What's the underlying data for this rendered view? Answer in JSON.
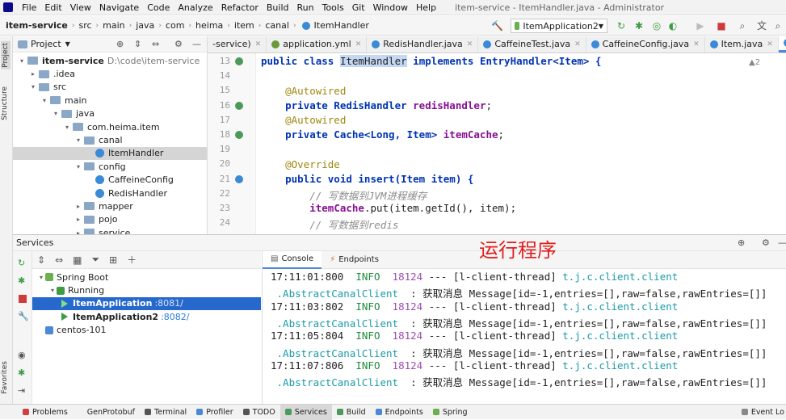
{
  "menu": {
    "items": [
      "File",
      "Edit",
      "View",
      "Navigate",
      "Code",
      "Analyze",
      "Refactor",
      "Build",
      "Run",
      "Tools",
      "Git",
      "Window",
      "Help"
    ],
    "window_title": "item-service - ItemHandler.java - Administrator"
  },
  "breadcrumb": [
    "item-service",
    "src",
    "main",
    "java",
    "com",
    "heima",
    "item",
    "canal",
    "ItemHandler"
  ],
  "run_config": "ItemApplication2",
  "project": {
    "header": "Project",
    "tree": [
      {
        "label": "item-service",
        "path": "D:\\code\\item-service",
        "indent": 0,
        "arrow": "▾",
        "icon": "folder",
        "bold": true
      },
      {
        "label": ".idea",
        "indent": 1,
        "arrow": "▸",
        "icon": "folder"
      },
      {
        "label": "src",
        "indent": 1,
        "arrow": "▾",
        "icon": "folder"
      },
      {
        "label": "main",
        "indent": 2,
        "arrow": "▾",
        "icon": "folder"
      },
      {
        "label": "java",
        "indent": 3,
        "arrow": "▾",
        "icon": "folder"
      },
      {
        "label": "com.heima.item",
        "indent": 4,
        "arrow": "▾",
        "icon": "folder"
      },
      {
        "label": "canal",
        "indent": 5,
        "arrow": "▾",
        "icon": "folder"
      },
      {
        "label": "ItemHandler",
        "indent": 6,
        "arrow": "",
        "icon": "class",
        "selected": true
      },
      {
        "label": "config",
        "indent": 5,
        "arrow": "▾",
        "icon": "folder"
      },
      {
        "label": "CaffeineConfig",
        "indent": 6,
        "arrow": "",
        "icon": "class"
      },
      {
        "label": "RedisHandler",
        "indent": 6,
        "arrow": "",
        "icon": "class"
      },
      {
        "label": "mapper",
        "indent": 5,
        "arrow": "▸",
        "icon": "folder"
      },
      {
        "label": "pojo",
        "indent": 5,
        "arrow": "▸",
        "icon": "folder"
      },
      {
        "label": "service",
        "indent": 5,
        "arrow": "▸",
        "icon": "folder"
      }
    ]
  },
  "editor_tabs": [
    {
      "label": "-service)",
      "color": "#8aa7c7"
    },
    {
      "label": "application.yml",
      "color": "#6a9a3a"
    },
    {
      "label": "RedisHandler.java",
      "color": "#3a8ad6"
    },
    {
      "label": "CaffeineTest.java",
      "color": "#3a8ad6"
    },
    {
      "label": "CaffeineConfig.java",
      "color": "#3a8ad6"
    },
    {
      "label": "Item.java",
      "color": "#3a8ad6"
    },
    {
      "label": "ItemHandler.java",
      "color": "#3a8ad6",
      "active": true
    }
  ],
  "line_numbers": [
    "13",
    "14",
    "15",
    "16",
    "17",
    "18",
    "19",
    "20",
    "21",
    "22",
    "23",
    "24"
  ],
  "warning_count": "▲2",
  "code": {
    "l13a": "public class ",
    "l13b": "ItemHandler",
    "l13c": " implements EntryHandler<Item> {",
    "l15": "    @Autowired",
    "l16a": "    private RedisHandler ",
    "l16b": "redisHandler",
    "l17": "    @Autowired",
    "l18a": "    private Cache<Long, Item> ",
    "l18b": "itemCache",
    "l20": "    @Override",
    "l21": "    public void insert(Item item) {",
    "l22": "        // 写数据到JVM进程缓存",
    "l23a": "        ",
    "l23b": "itemCache",
    "l23c": ".put(item.getId(), item);",
    "l24": "        // 写数据到redis"
  },
  "services": {
    "header": "Services",
    "tree": [
      {
        "label": "Spring Boot",
        "indent": 0
      },
      {
        "label": "Running",
        "indent": 1
      },
      {
        "label": "ItemApplication",
        "port": ":8081/",
        "indent": 2,
        "selected": true
      },
      {
        "label": "ItemApplication2",
        "port": ":8082/",
        "indent": 2
      },
      {
        "label": "centos-101",
        "indent": 0
      }
    ]
  },
  "console_tabs": [
    "Console",
    "Endpoints"
  ],
  "annotation": "运行程序",
  "logs": [
    {
      "time": "17:11:01:800",
      "level": "INFO",
      "pid": "18124",
      "thread": " --- [l-client-thread] ",
      "cls": "t.j.c.client.client",
      "cls2": " .AbstractCanalClient",
      "msg": "  : 获取消息 Message[id=-1,entries=[],raw=false,rawEntries=[]]"
    },
    {
      "time": "17:11:03:802",
      "level": "INFO",
      "pid": "18124",
      "thread": " --- [l-client-thread] ",
      "cls": "t.j.c.client.client",
      "cls2": " .AbstractCanalClient",
      "msg": "  : 获取消息 Message[id=-1,entries=[],raw=false,rawEntries=[]]"
    },
    {
      "time": "17:11:05:804",
      "level": "INFO",
      "pid": "18124",
      "thread": " --- [l-client-thread] ",
      "cls": "t.j.c.client.client",
      "cls2": " .AbstractCanalClient",
      "msg": "  : 获取消息 Message[id=-1,entries=[],raw=false,rawEntries=[]]"
    },
    {
      "time": "17:11:07:806",
      "level": "INFO",
      "pid": "18124",
      "thread": " --- [l-client-thread] ",
      "cls": "t.j.c.client.client",
      "cls2": " .AbstractCanalClient",
      "msg": "  : 获取消息 Message[id=-1,entries=[],raw=false,rawEntries=[]]"
    }
  ],
  "left_strip": [
    "Project",
    "Structure",
    "Favorites"
  ],
  "bottom_tabs": [
    {
      "label": "Problems",
      "color": "#d04040"
    },
    {
      "label": "GenProtobuf",
      "color": "#f2f2f2"
    },
    {
      "label": "Terminal",
      "color": "#555555"
    },
    {
      "label": "Profiler",
      "color": "#4a88d8"
    },
    {
      "label": "TODO",
      "color": "#555555"
    },
    {
      "label": "Services",
      "color": "#4c9a5a",
      "active": true
    },
    {
      "label": "Build",
      "color": "#4c9a5a"
    },
    {
      "label": "Endpoints",
      "color": "#4a88d8"
    },
    {
      "label": "Spring",
      "color": "#6ab04c"
    }
  ],
  "event_log": "Event Lo"
}
